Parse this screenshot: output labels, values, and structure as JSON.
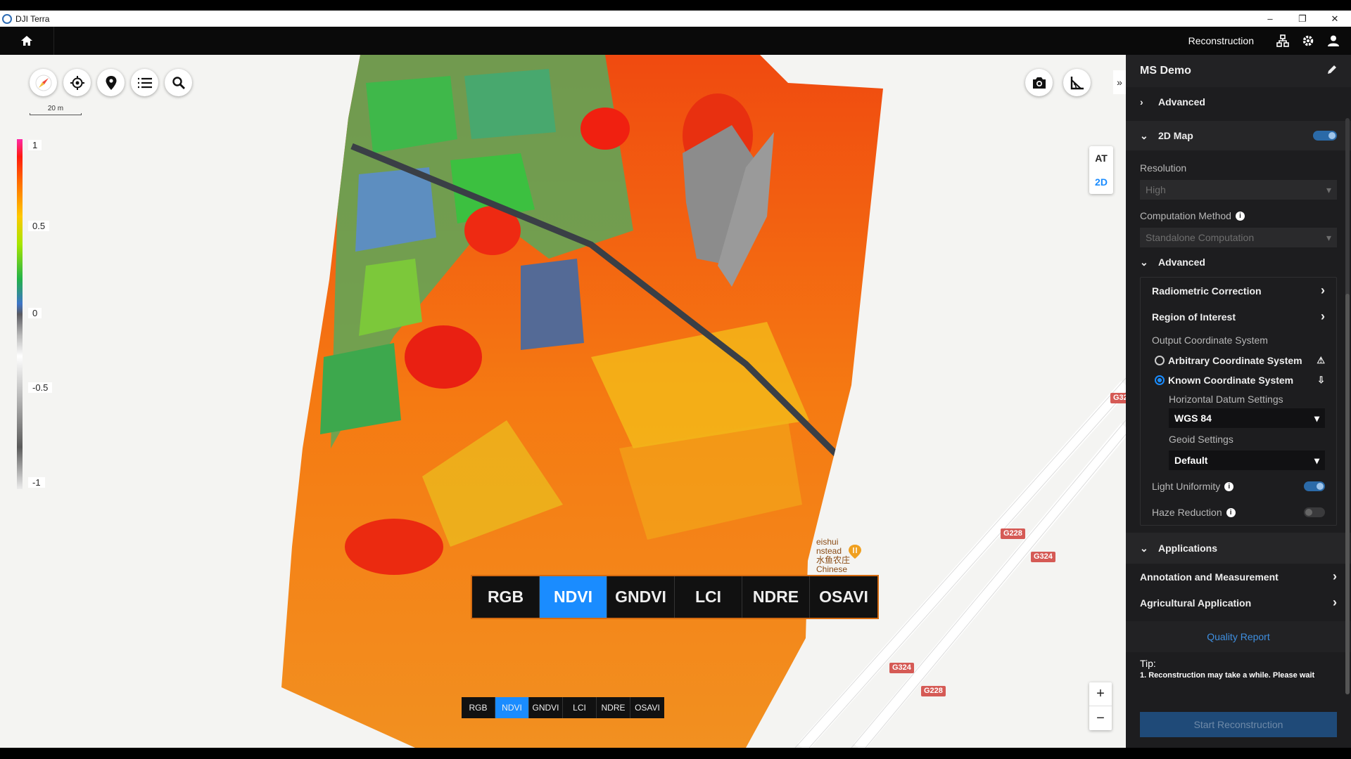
{
  "window": {
    "title": "DJI Terra",
    "controls": [
      "–",
      "❐",
      "✕"
    ]
  },
  "header": {
    "title": "Reconstruction"
  },
  "map": {
    "scale_label": "20 m",
    "legend": [
      "1",
      "0.5",
      "0",
      "-0.5",
      "-1"
    ],
    "view_modes": [
      "AT",
      "2D"
    ],
    "active_view": "2D",
    "zoom_in": "+",
    "zoom_out": "−",
    "road_badges": [
      "G32",
      "G228",
      "G324",
      "G324",
      "G228"
    ],
    "poi_lines": [
      "eishui",
      "nstead",
      "水鱼农庄",
      "Chinese"
    ],
    "bands": [
      "RGB",
      "NDVI",
      "GNDVI",
      "LCI",
      "NDRE",
      "OSAVI"
    ],
    "active_band": "NDVI"
  },
  "panel": {
    "project_name": "MS Demo",
    "advanced_top": "Advanced",
    "map2d": "2D Map",
    "resolution_label": "Resolution",
    "resolution_value": "High",
    "computation_label": "Computation Method",
    "computation_value": "Standalone Computation",
    "advanced": "Advanced",
    "radiometric": "Radiometric Correction",
    "roi": "Region of Interest",
    "output_cs": "Output Coordinate System",
    "arbitrary_cs": "Arbitrary Coordinate System",
    "known_cs": "Known Coordinate System",
    "horizontal_datum": "Horizontal Datum Settings",
    "horizontal_value": "WGS 84",
    "geoid": "Geoid Settings",
    "geoid_value": "Default",
    "light_uniformity": "Light Uniformity",
    "haze_reduction": "Haze Reduction",
    "applications": "Applications",
    "annotation": "Annotation and Measurement",
    "agricultural": "Agricultural Application",
    "quality_report": "Quality Report",
    "tip_title": "Tip:",
    "tip_text": "1. Reconstruction may take a while. Please wait",
    "start_button": "Start Reconstruction"
  },
  "colors": {
    "accent": "#1a8cff",
    "panel_bg": "#1d1d1f",
    "badge": "#d55a55"
  }
}
